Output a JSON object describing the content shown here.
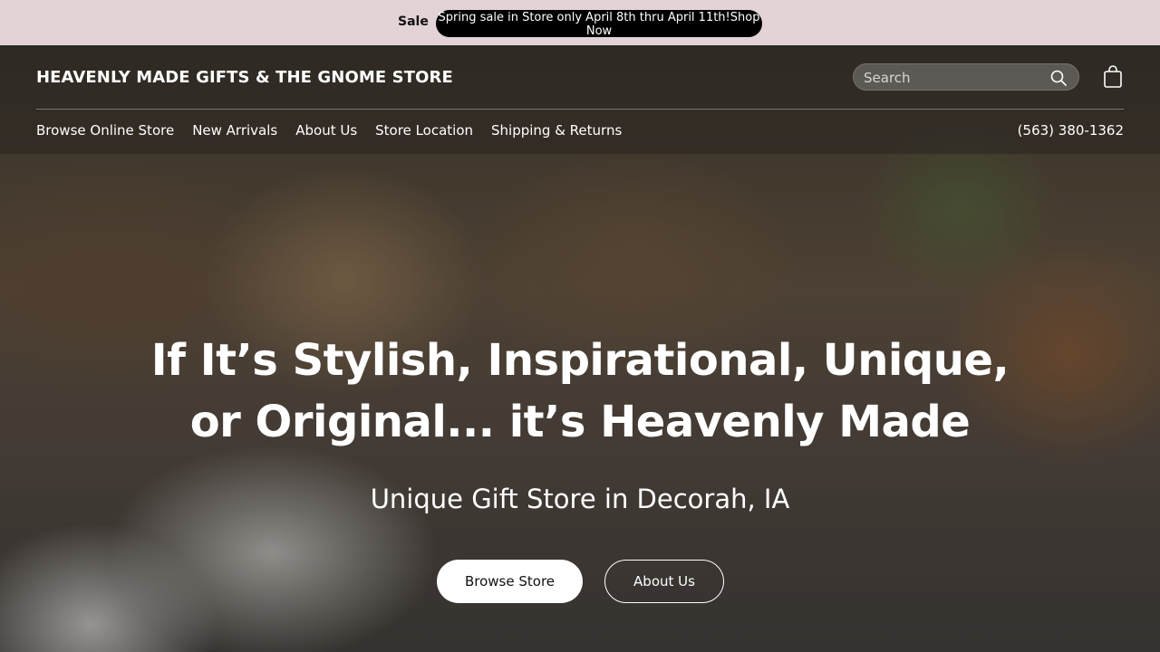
{
  "announcement": {
    "label": "Sale",
    "message": "Spring sale in Store only April 8th thru April 11th!Shop Now"
  },
  "header": {
    "brand": "HEAVENLY MADE GIFTS & THE GNOME STORE",
    "search_placeholder": "Search",
    "search_icon": "search-icon",
    "cart_icon": "shopping-bag-icon",
    "nav": [
      {
        "label": "Browse Online Store"
      },
      {
        "label": "New Arrivals"
      },
      {
        "label": "About Us"
      },
      {
        "label": "Store Location"
      },
      {
        "label": "Shipping & Returns"
      }
    ],
    "phone": "(563) 380-1362"
  },
  "hero": {
    "title_line1": "If It’s Stylish, Inspirational, Unique,",
    "title_line2": "or Original... it’s Heavenly Made",
    "subtitle": "Unique Gift Store in Decorah, IA",
    "primary_button": "Browse Store",
    "secondary_button": "About Us"
  },
  "colors": {
    "announcement_bg": "#e3d3d6",
    "pill_bg": "#000000",
    "text_light": "#ffffff"
  }
}
